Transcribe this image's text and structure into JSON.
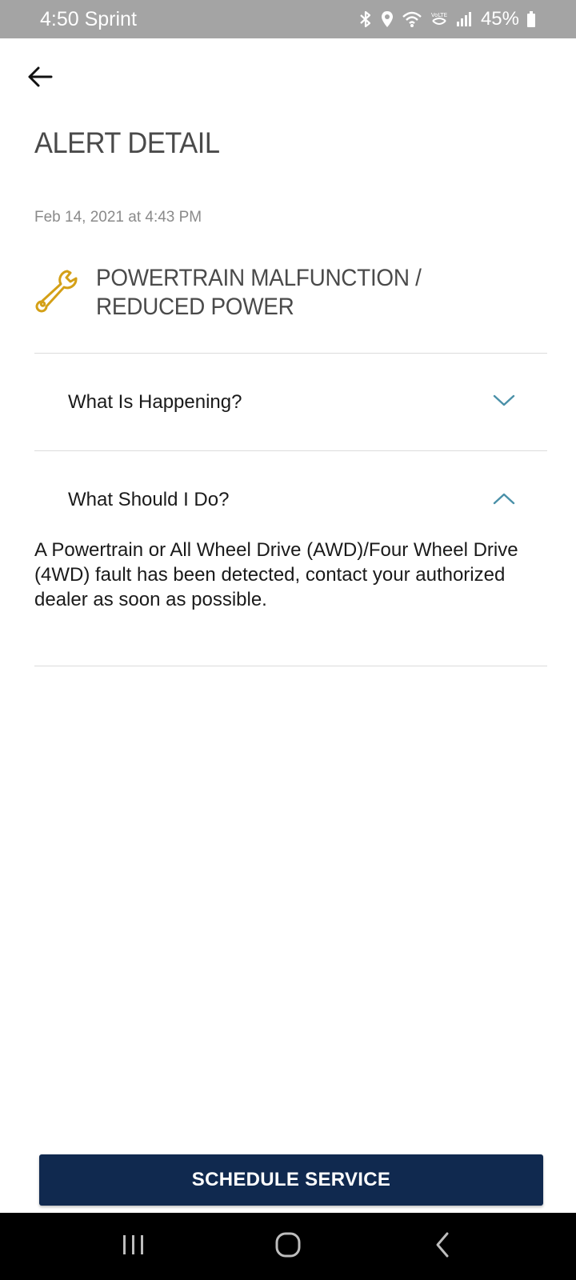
{
  "status_bar": {
    "time_carrier": "4:50 Sprint",
    "battery_percent": "45%",
    "icons": [
      "bluetooth-icon",
      "location-icon",
      "wifi-icon",
      "volte-icon",
      "signal-icon",
      "battery-icon"
    ]
  },
  "header": {
    "back_icon": "back-arrow-icon",
    "title": "ALERT DETAIL"
  },
  "alert": {
    "timestamp": "Feb 14, 2021 at 4:43 PM",
    "icon": "wrench-icon",
    "title": "POWERTRAIN MALFUNCTION / REDUCED POWER"
  },
  "accordions": [
    {
      "label": "What Is Happening?",
      "expanded": false
    },
    {
      "label": "What Should I Do?",
      "expanded": true,
      "content": "A Powertrain or All Wheel Drive (AWD)/Four Wheel Drive (4WD) fault has been detected, contact your authorized dealer as soon as possible."
    }
  ],
  "actions": {
    "schedule_label": "SCHEDULE SERVICE"
  },
  "nav_bar": {
    "icons": [
      "recent-apps-icon",
      "home-icon",
      "back-icon"
    ]
  },
  "colors": {
    "status_bar": "#a4a4a4",
    "accent_gold": "#d4a017",
    "chevron_teal": "#4a90a8",
    "button_navy": "#10294f",
    "title_gray": "#4a4a4a"
  }
}
